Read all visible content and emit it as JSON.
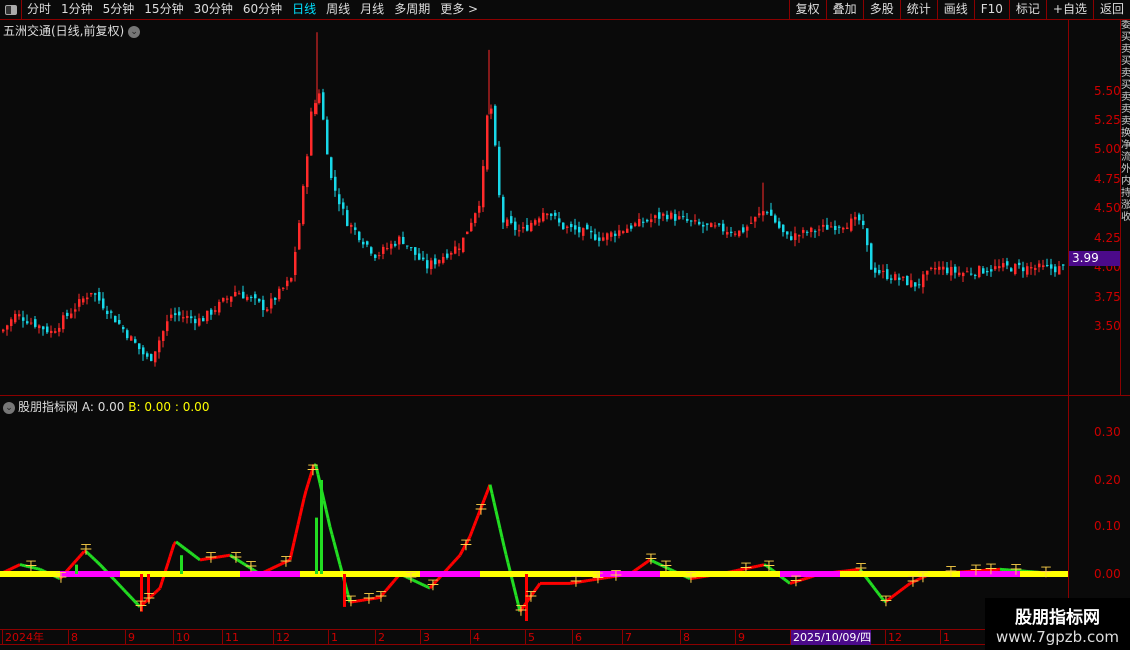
{
  "toolbar": {
    "periods": [
      "分时",
      "1分钟",
      "5分钟",
      "15分钟",
      "30分钟",
      "60分钟",
      "日线",
      "周线",
      "月线",
      "多周期",
      "更多 >"
    ],
    "active": "日线",
    "right": [
      "复权",
      "叠加",
      "多股",
      "统计",
      "画线",
      "F10",
      "标记",
      "+自选",
      "返回"
    ]
  },
  "main": {
    "title": "五洲交通(日线,前复权)",
    "price_badge": "3.99",
    "price_labels": [
      "5.50",
      "5.25",
      "5.00",
      "4.75",
      "4.50",
      "4.25",
      "4.00",
      "3.75",
      "3.50"
    ]
  },
  "indicator": {
    "name": "股朋指标网",
    "a_label": "A: 0.00",
    "b_label": "B: 0.00 : 0.00",
    "axis_labels": [
      "0.30",
      "0.20",
      "0.10",
      "0.00"
    ]
  },
  "right_strip": "委买卖买卖买卖卖卖换净流外内持涨收",
  "date_axis": [
    "2024年",
    "8",
    "9",
    "10",
    "11",
    "12",
    "1",
    "2",
    "3",
    "4",
    "5",
    "6",
    "7",
    "8",
    "9",
    "2025/10/09/四",
    "12",
    "1"
  ],
  "watermark": {
    "line1": "股朋指标网",
    "line2": "www.7gpzb.com"
  },
  "colors": {
    "up": "#ff2a2a",
    "down": "#18d8e8",
    "axis": "#8b0000",
    "ind_up": "#ff0000",
    "ind_down": "#22dd22",
    "baseline_a": "#ffff00",
    "baseline_b": "#ff00ff",
    "accent": "#00e0ff"
  },
  "chart_data": [
    {
      "type": "candlestick",
      "title": "五洲交通(日线,前复权)",
      "ylim": [
        3.1,
        6.0
      ],
      "last": 3.99,
      "close_path": [
        [
          0,
          3.45
        ],
        [
          15,
          3.6
        ],
        [
          50,
          3.45
        ],
        [
          90,
          3.8
        ],
        [
          110,
          3.6
        ],
        [
          148,
          3.2
        ],
        [
          170,
          3.6
        ],
        [
          200,
          3.55
        ],
        [
          235,
          3.8
        ],
        [
          265,
          3.65
        ],
        [
          290,
          3.9
        ],
        [
          300,
          4.5
        ],
        [
          310,
          5.3
        ],
        [
          318,
          5.5
        ],
        [
          330,
          4.75
        ],
        [
          345,
          4.4
        ],
        [
          375,
          4.1
        ],
        [
          400,
          4.25
        ],
        [
          425,
          4.0
        ],
        [
          460,
          4.2
        ],
        [
          480,
          4.6
        ],
        [
          488,
          5.5
        ],
        [
          492,
          5.2
        ],
        [
          500,
          4.4
        ],
        [
          520,
          4.3
        ],
        [
          545,
          4.5
        ],
        [
          560,
          4.35
        ],
        [
          600,
          4.25
        ],
        [
          630,
          4.35
        ],
        [
          665,
          4.45
        ],
        [
          700,
          4.35
        ],
        [
          740,
          4.3
        ],
        [
          765,
          4.5
        ],
        [
          785,
          4.25
        ],
        [
          830,
          4.35
        ],
        [
          860,
          4.4
        ],
        [
          870,
          4.0
        ],
        [
          880,
          3.95
        ],
        [
          915,
          3.85
        ],
        [
          935,
          4.0
        ],
        [
          960,
          3.95
        ],
        [
          1000,
          4.0
        ],
        [
          1060,
          3.99
        ]
      ]
    },
    {
      "type": "line",
      "title": "股朋指标网",
      "ylim": [
        -0.1,
        0.36
      ],
      "path": [
        [
          0,
          0
        ],
        [
          20,
          0.02
        ],
        [
          40,
          0.01
        ],
        [
          60,
          -0.01
        ],
        [
          85,
          0.05
        ],
        [
          100,
          0.02
        ],
        [
          140,
          -0.07
        ],
        [
          160,
          -0.03
        ],
        [
          175,
          0.07
        ],
        [
          200,
          0.03
        ],
        [
          230,
          0.04
        ],
        [
          260,
          0.0
        ],
        [
          290,
          0.03
        ],
        [
          305,
          0.17
        ],
        [
          315,
          0.24
        ],
        [
          330,
          0.1
        ],
        [
          350,
          -0.06
        ],
        [
          380,
          -0.05
        ],
        [
          400,
          0.0
        ],
        [
          430,
          -0.03
        ],
        [
          460,
          0.04
        ],
        [
          470,
          0.08
        ],
        [
          490,
          0.19
        ],
        [
          505,
          0.05
        ],
        [
          520,
          -0.08
        ],
        [
          540,
          -0.02
        ],
        [
          570,
          -0.02
        ],
        [
          600,
          -0.01
        ],
        [
          630,
          0.0
        ],
        [
          650,
          0.03
        ],
        [
          690,
          -0.01
        ],
        [
          720,
          0.0
        ],
        [
          765,
          0.02
        ],
        [
          790,
          -0.02
        ],
        [
          820,
          0.0
        ],
        [
          860,
          0.01
        ],
        [
          885,
          -0.06
        ],
        [
          910,
          -0.02
        ],
        [
          930,
          0.0
        ],
        [
          1000,
          0.01
        ],
        [
          1060,
          0.0
        ]
      ]
    }
  ]
}
